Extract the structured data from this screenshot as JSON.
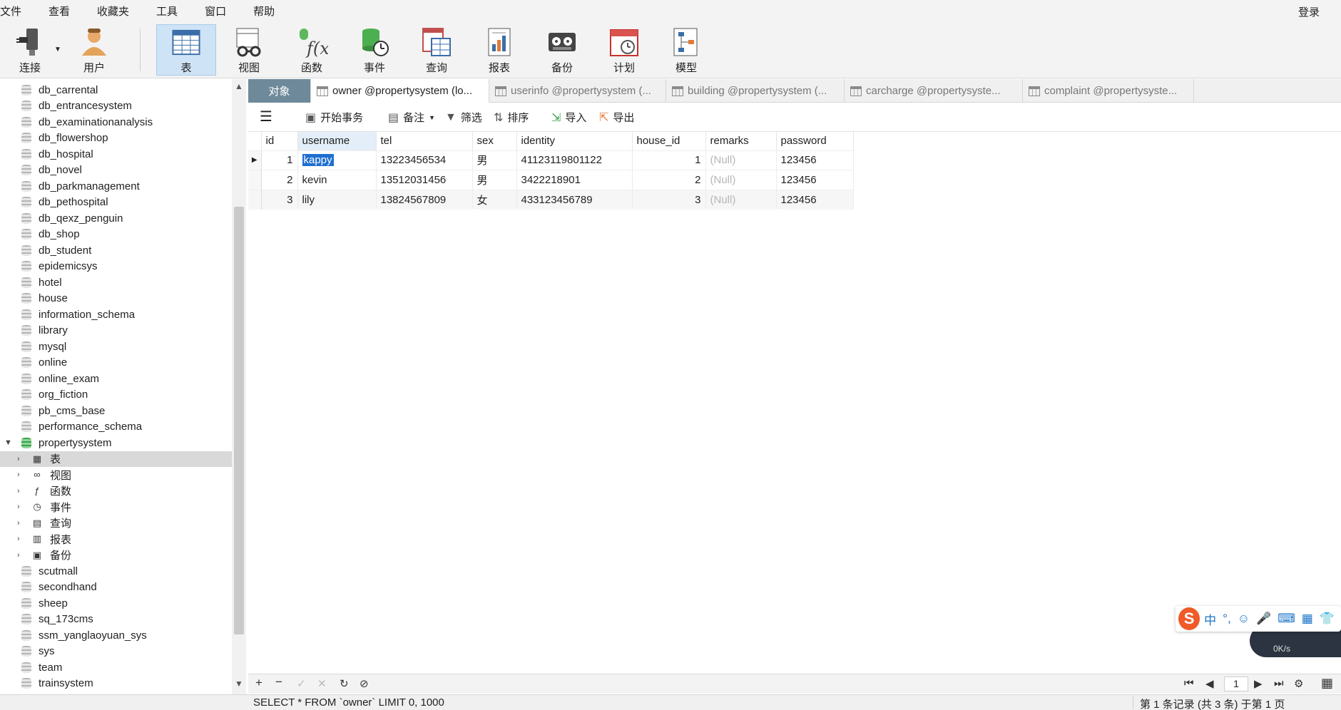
{
  "menu": [
    "文件",
    "查看",
    "收藏夹",
    "工具",
    "窗口",
    "帮助"
  ],
  "login_label": "登录",
  "toolbar": [
    {
      "label": "连接",
      "icon": "plug-icon"
    },
    {
      "label": "用户",
      "icon": "user-icon"
    },
    {
      "label": "表",
      "icon": "table-icon"
    },
    {
      "label": "视图",
      "icon": "view-glasses-icon"
    },
    {
      "label": "函数",
      "icon": "function-icon"
    },
    {
      "label": "事件",
      "icon": "event-clock-icon"
    },
    {
      "label": "查询",
      "icon": "query-icon"
    },
    {
      "label": "报表",
      "icon": "report-icon"
    },
    {
      "label": "备份",
      "icon": "backup-tape-icon"
    },
    {
      "label": "计划",
      "icon": "calendar-icon"
    },
    {
      "label": "模型",
      "icon": "model-icon"
    }
  ],
  "sidebar": {
    "databases_before": [
      "db_carrental",
      "db_entrancesystem",
      "db_examinationanalysis",
      "db_flowershop",
      "db_hospital",
      "db_novel",
      "db_parkmanagement",
      "db_pethospital",
      "db_qexz_penguin",
      "db_shop",
      "db_student",
      "epidemicsys",
      "hotel",
      "house",
      "information_schema",
      "library",
      "mysql",
      "online",
      "online_exam",
      "org_fiction",
      "pb_cms_base",
      "performance_schema"
    ],
    "open_db": "propertysystem",
    "open_db_children": [
      {
        "label": "表",
        "icon": "table-icon"
      },
      {
        "label": "视图",
        "icon": "view-glasses-icon"
      },
      {
        "label": "函数",
        "icon": "function-icon"
      },
      {
        "label": "事件",
        "icon": "event-clock-icon"
      },
      {
        "label": "查询",
        "icon": "query-icon"
      },
      {
        "label": "报表",
        "icon": "report-icon"
      },
      {
        "label": "备份",
        "icon": "backup-tape-icon"
      }
    ],
    "databases_after": [
      "scutmall",
      "secondhand",
      "sheep",
      "sq_173cms",
      "ssm_yanglaoyuan_sys",
      "sys",
      "team",
      "trainsystem"
    ]
  },
  "tabs": [
    {
      "label": "对象"
    },
    {
      "label": "owner @propertysystem (lo..."
    },
    {
      "label": "userinfo @propertysystem (..."
    },
    {
      "label": "building @propertysystem (..."
    },
    {
      "label": "carcharge @propertysyste..."
    },
    {
      "label": "complaint @propertysyste..."
    }
  ],
  "grid_tools": {
    "begin_tx": "开始事务",
    "note": "备注",
    "filter": "筛选",
    "sort": "排序",
    "import": "导入",
    "export": "导出"
  },
  "table": {
    "columns": [
      "id",
      "username",
      "tel",
      "sex",
      "identity",
      "house_id",
      "remarks",
      "password"
    ],
    "rows": [
      [
        "1",
        "kappy",
        "13223456534",
        "男",
        "41123119801122",
        "1",
        "(Null)",
        "123456"
      ],
      [
        "2",
        "kevin",
        "13512031456",
        "男",
        "3422218901",
        "2",
        "(Null)",
        "123456"
      ],
      [
        "3",
        "lily",
        "13824567809",
        "女",
        "433123456789",
        "3",
        "(Null)",
        "123456"
      ]
    ]
  },
  "nav": {
    "page": "1"
  },
  "status": {
    "sql": "SELECT * FROM `owner` LIMIT 0, 1000",
    "records": "第 1 条记录 (共 3 条) 于第 1 页"
  },
  "ime": {
    "logo": "S",
    "lang": "中",
    "net": "0K/s"
  }
}
